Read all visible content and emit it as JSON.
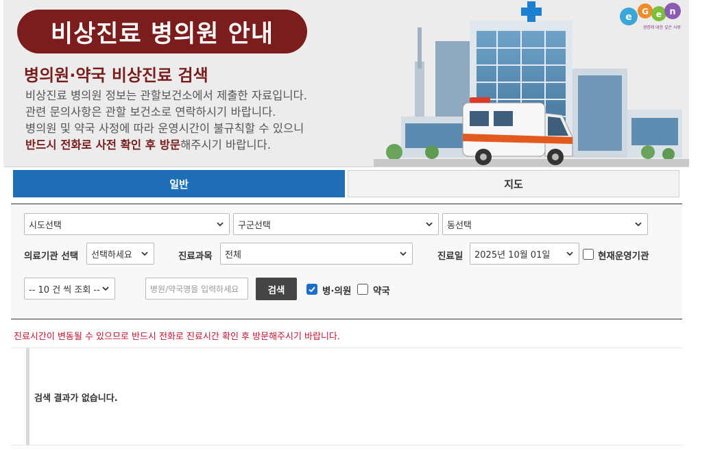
{
  "banner": {
    "title": "비상진료 병의원 안내",
    "subtitle": "병의원·약국 비상진료 검색",
    "line1": "비상진료 병의원 정보는 관할보건소에서 제출한 자료입니다.",
    "line2": "관련 문의사항은 관할 보건소로 연락하시기 바랍니다.",
    "line3": "병의원 및 약국 사정에 따라 운영시간이 불규칙할 수 있으니",
    "line4_strong": "반드시 전화로 사전 확인 후 방문",
    "line4_rest": "해주시기 바랍니다.",
    "logo_text": "E-GEN",
    "logo_tagline": "생명에 대한 깊은 사랑"
  },
  "tabs": {
    "general": "일반",
    "map": "지도"
  },
  "search": {
    "sido": "시도선택",
    "gugun": "구군선택",
    "dong": "동선택",
    "institution_label": "의료기관 선택",
    "institution_value": "선택하세요",
    "department_label": "진료과목",
    "department_value": "전체",
    "date_label": "진료일",
    "date_value": "2025년 10월 01일",
    "open_now_label": "현재운영기관",
    "page_size": "-- 10 건 씩 조회 --",
    "keyword_placeholder": "병원/약국명을 입력하세요",
    "search_button": "검색",
    "hospital_label": "병·의원",
    "pharmacy_label": "약국"
  },
  "notice": "진료시간이 변동될 수 있으므로 반드시 전화로 진료시간 확인 후 방문해주시기 바랍니다.",
  "results": {
    "empty_message": "검색 결과가 없습니다."
  },
  "colors": {
    "banner_red": "#7d1c1c",
    "tab_active": "#1f6fb8",
    "notice_red": "#c4122f"
  }
}
